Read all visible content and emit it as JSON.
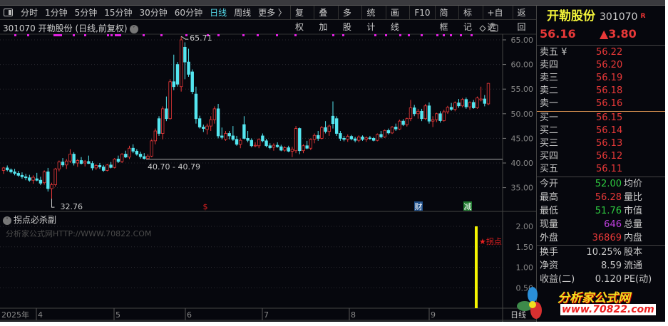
{
  "toolbar": {
    "periods": [
      "分时",
      "1分钟",
      "5分钟",
      "15分钟",
      "30分钟",
      "60分钟",
      "日线",
      "周线",
      "更多 〉"
    ],
    "active": "日线",
    "actions": [
      "复权",
      "叠加",
      "多股",
      "统计",
      "画线",
      "F10",
      "简框",
      "标记",
      "+自选",
      "返回"
    ]
  },
  "chart": {
    "title": "301070 开勒股份 (日线,前复权)",
    "high_label": "65.71",
    "low_label": "32.76",
    "range_label": "40.70 - 40.79",
    "y_ticks": [
      "65.00",
      "60.00",
      "55.00",
      "50.00",
      "45.00",
      "40.00",
      "35.00"
    ],
    "markers": [
      {
        "text": "$",
        "color": "#e02020"
      },
      {
        "text": "财",
        "color": "#1e4f8a"
      },
      {
        "text": "减",
        "color": "#1e7a2e"
      }
    ],
    "up_color": "#e83838",
    "down_color": "#54e6f0",
    "candles": [
      [
        38.5,
        39.2,
        37.8,
        39.0
      ],
      [
        39,
        39.5,
        38.3,
        38.6
      ],
      [
        38.6,
        38.9,
        37.9,
        38.2
      ],
      [
        38.2,
        38.8,
        37.5,
        37.9
      ],
      [
        37.9,
        38.4,
        37.2,
        37.5
      ],
      [
        37.5,
        38.1,
        36.8,
        37.2
      ],
      [
        37.2,
        37.8,
        36.5,
        37.0
      ],
      [
        37,
        37.6,
        36.2,
        36.5
      ],
      [
        36.5,
        37.5,
        35.8,
        37.1
      ],
      [
        36.8,
        38.0,
        36.3,
        36.5
      ],
      [
        36.5,
        37.2,
        35.5,
        35.9
      ],
      [
        36,
        38.5,
        35.6,
        38.2
      ],
      [
        38.2,
        39,
        34.2,
        34.8
      ],
      [
        34.8,
        36,
        32.76,
        35.6
      ],
      [
        35.6,
        39,
        35.2,
        38.8
      ],
      [
        38.8,
        40.5,
        38.3,
        40.2
      ],
      [
        40.2,
        41,
        39.2,
        39.6
      ],
      [
        39.6,
        40.8,
        38.8,
        40.4
      ],
      [
        40.4,
        42.8,
        40.0,
        41.8
      ],
      [
        41.8,
        42.2,
        39.5,
        40.0
      ],
      [
        40,
        40.8,
        39.2,
        40.5
      ],
      [
        40.5,
        41.2,
        39.7,
        39.9
      ],
      [
        40,
        40.6,
        39.3,
        40.3
      ],
      [
        40.3,
        41.5,
        39.8,
        39.9
      ],
      [
        39.9,
        40.4,
        38.5,
        39.0
      ],
      [
        39,
        39.8,
        38.6,
        39.5
      ],
      [
        39.5,
        40,
        38.8,
        39.2
      ],
      [
        39.2,
        39.6,
        38.2,
        38.5
      ],
      [
        38.5,
        39.8,
        38.3,
        39.6
      ],
      [
        39.6,
        40.2,
        38.9,
        39.1
      ],
      [
        39.1,
        41,
        38.9,
        40.8
      ],
      [
        40.8,
        41.5,
        40,
        40.3
      ],
      [
        40.3,
        42,
        40,
        41.8
      ],
      [
        41.8,
        42.5,
        41,
        41.2
      ],
      [
        41.2,
        43.5,
        40.8,
        43.0
      ],
      [
        43,
        43.8,
        42,
        42.4
      ],
      [
        42.4,
        42.8,
        41.5,
        41.8
      ],
      [
        41.8,
        42.3,
        40.9,
        41.3
      ],
      [
        41.3,
        42,
        40.7,
        40.9
      ],
      [
        40.9,
        41.8,
        40.7,
        41.4
      ],
      [
        41.4,
        44.8,
        41.2,
        44.5
      ],
      [
        44.5,
        47,
        43.8,
        46.5
      ],
      [
        49,
        49.5,
        45.5,
        46
      ],
      [
        46,
        51.5,
        44.8,
        51
      ],
      [
        51,
        53.5,
        48.5,
        49
      ],
      [
        49,
        57,
        48.8,
        56.5
      ],
      [
        56.5,
        62,
        54.8,
        55.5
      ],
      [
        60,
        60.5,
        55.5,
        56
      ],
      [
        55.5,
        65.71,
        54.5,
        65
      ],
      [
        63.5,
        64.5,
        57,
        60.5
      ],
      [
        60.5,
        63.2,
        57.5,
        58
      ],
      [
        58.5,
        59,
        54,
        54.5
      ],
      [
        54,
        55.5,
        48,
        49
      ],
      [
        49,
        49.6,
        47,
        47.3
      ],
      [
        47.3,
        47.8,
        46.3,
        47.0
      ],
      [
        46.8,
        48,
        45.8,
        47.5
      ],
      [
        47.5,
        49.5,
        46.5,
        48.8
      ],
      [
        48.8,
        51.5,
        48,
        51
      ],
      [
        51,
        52,
        45,
        45.5
      ],
      [
        45.5,
        47.2,
        44.8,
        45.2
      ],
      [
        44.8,
        46.5,
        44.5,
        46.0
      ],
      [
        46,
        46.5,
        44.8,
        45.5
      ],
      [
        45.5,
        47.5,
        44.5,
        44.8
      ],
      [
        44.8,
        45.5,
        43.5,
        43.8
      ],
      [
        43.8,
        45,
        43,
        44.6
      ],
      [
        47.8,
        49.5,
        44.8,
        45
      ],
      [
        45,
        46.5,
        44.2,
        44.6
      ],
      [
        44.6,
        45,
        43.2,
        43.5
      ],
      [
        43.5,
        44.2,
        43.2,
        43.6
      ],
      [
        43.5,
        45,
        43,
        44.8
      ],
      [
        45.5,
        46,
        44.2,
        44.5
      ],
      [
        44.5,
        44.9,
        43.2,
        43.5
      ],
      [
        43.5,
        44,
        42.8,
        43.1
      ],
      [
        43.2,
        44,
        42.5,
        43.6
      ],
      [
        43.6,
        44.2,
        43.1,
        43.3
      ],
      [
        43.3,
        43.7,
        42.4,
        42.6
      ],
      [
        42.6,
        43.4,
        42.3,
        43.1
      ],
      [
        43.1,
        43.5,
        42.2,
        42.4
      ],
      [
        42.4,
        43.3,
        41.2,
        42.8
      ],
      [
        42.5,
        47.5,
        42,
        47
      ],
      [
        47,
        47.2,
        41.8,
        42.5
      ],
      [
        42.5,
        43.8,
        42,
        43.5
      ],
      [
        43.5,
        44.5,
        42.8,
        43.0
      ],
      [
        43,
        45,
        42.6,
        44.8
      ],
      [
        44.8,
        46,
        44,
        45.6
      ],
      [
        45.6,
        46.5,
        44.5,
        45
      ],
      [
        45,
        47.5,
        44.8,
        47.2
      ],
      [
        47.2,
        48.5,
        46,
        46.4
      ],
      [
        46.4,
        47.8,
        45.5,
        47.5
      ],
      [
        49.5,
        52.5,
        47,
        48
      ],
      [
        49,
        49.5,
        45.5,
        46
      ],
      [
        46,
        46.5,
        44.5,
        45
      ],
      [
        45,
        45.5,
        44.4,
        44.8
      ],
      [
        44.8,
        45.8,
        44.3,
        45.4
      ],
      [
        45.4,
        45.7,
        44.6,
        44.9
      ],
      [
        44.9,
        45.3,
        44.2,
        44.6
      ],
      [
        44.6,
        45.6,
        44.2,
        45.3
      ],
      [
        45.3,
        45.6,
        44.5,
        44.8
      ],
      [
        44.8,
        45.4,
        44.3,
        45.1
      ],
      [
        45.1,
        45.5,
        44.7,
        45.0
      ],
      [
        45,
        45.3,
        44.4,
        44.6
      ],
      [
        44.6,
        46,
        44.4,
        45.8
      ],
      [
        45.8,
        46.5,
        45,
        45.3
      ],
      [
        45.3,
        46.8,
        45.1,
        46.6
      ],
      [
        46.6,
        47,
        45.8,
        46.1
      ],
      [
        46.1,
        47.5,
        45.9,
        47.3
      ],
      [
        47.3,
        48,
        46.5,
        46.9
      ],
      [
        46.9,
        48.8,
        46.7,
        48.5
      ],
      [
        48.5,
        48.9,
        47.5,
        47.8
      ],
      [
        47.8,
        49.2,
        47.4,
        49
      ],
      [
        49,
        52.8,
        48.5,
        51.2
      ],
      [
        51.2,
        51.8,
        49.5,
        50
      ],
      [
        50,
        51,
        49,
        50.5
      ],
      [
        50.5,
        51,
        48.5,
        49
      ],
      [
        49,
        52,
        48.7,
        51.6
      ],
      [
        51.6,
        52.3,
        48,
        48.5
      ],
      [
        48.5,
        49.5,
        47.3,
        48.8
      ],
      [
        48.8,
        50.2,
        48.3,
        50
      ],
      [
        50,
        50.5,
        48.2,
        48.6
      ],
      [
        48.6,
        50.8,
        48.4,
        50.4
      ],
      [
        50.4,
        51.6,
        50,
        51.3
      ],
      [
        51.3,
        52.2,
        50.6,
        50.9
      ],
      [
        50.9,
        52.5,
        50.5,
        52.2
      ],
      [
        52.2,
        53,
        51.2,
        51.6
      ],
      [
        51.6,
        53.2,
        51.3,
        52.9
      ],
      [
        52.9,
        53.3,
        51,
        51.4
      ],
      [
        51.4,
        52.5,
        50.8,
        52.3
      ],
      [
        52.3,
        52.8,
        51,
        51.2
      ],
      [
        51.2,
        53.5,
        51,
        53.2
      ],
      [
        52.8,
        55.5,
        52.5,
        53
      ],
      [
        53,
        53.8,
        51.5,
        52.1
      ],
      [
        52,
        56.28,
        51.76,
        56.16
      ]
    ]
  },
  "indicator": {
    "title": "拐点必杀副",
    "watermark": "分析家公式网HTTP://WWW.70822.COM",
    "signal_label": "★拐点",
    "signal_value": 2.0,
    "y_ticks": [
      "2.00",
      "1.50",
      "1.00",
      "0.50"
    ]
  },
  "date_axis": {
    "labels": [
      "2025年",
      "4",
      "5",
      "6",
      "7",
      "8",
      "9"
    ],
    "period": "日线"
  },
  "quote": {
    "name": "开勒股份",
    "code": "301070",
    "flag": "R",
    "price": "56.16",
    "change": "▲3.80",
    "sell": [
      {
        "label": "卖五 ¥",
        "price": "56.22"
      },
      {
        "label": "卖四",
        "price": "56.20"
      },
      {
        "label": "卖三",
        "price": "56.19"
      },
      {
        "label": "卖二",
        "price": "56.18"
      },
      {
        "label": "卖一",
        "price": "56.16"
      }
    ],
    "buy": [
      {
        "label": "买一",
        "price": "56.15"
      },
      {
        "label": "买二",
        "price": "56.14"
      },
      {
        "label": "买三",
        "price": "56.13"
      },
      {
        "label": "买四",
        "price": "56.12"
      },
      {
        "label": "买五",
        "price": "56.11"
      }
    ],
    "stats": [
      {
        "label": "今开",
        "value": "52.00",
        "color": "#2ecc40",
        "right": "均价"
      },
      {
        "label": "最高",
        "value": "56.28",
        "color": "#e83838",
        "right": "量比"
      },
      {
        "label": "最低",
        "value": "51.76",
        "color": "#2ecc40",
        "right": "市值"
      },
      {
        "label": "现量",
        "value": "646",
        "color": "#c040e0",
        "right": "总量"
      },
      {
        "label": "外盘",
        "value": "36869",
        "color": "#e83838",
        "right": "内盘"
      }
    ],
    "stats2": [
      {
        "label": "换手",
        "value": "10.25%",
        "color": "#c8c8c8",
        "right": "股本"
      },
      {
        "label": "净资",
        "value": "8.59",
        "color": "#c8c8c8",
        "right": "流通"
      },
      {
        "label": "收益(二)",
        "value": "0.120",
        "color": "#c8c8c8",
        "right": "PE(动)"
      }
    ]
  },
  "logo": {
    "text": "分析家公式网",
    "url": "www.70822.com"
  }
}
